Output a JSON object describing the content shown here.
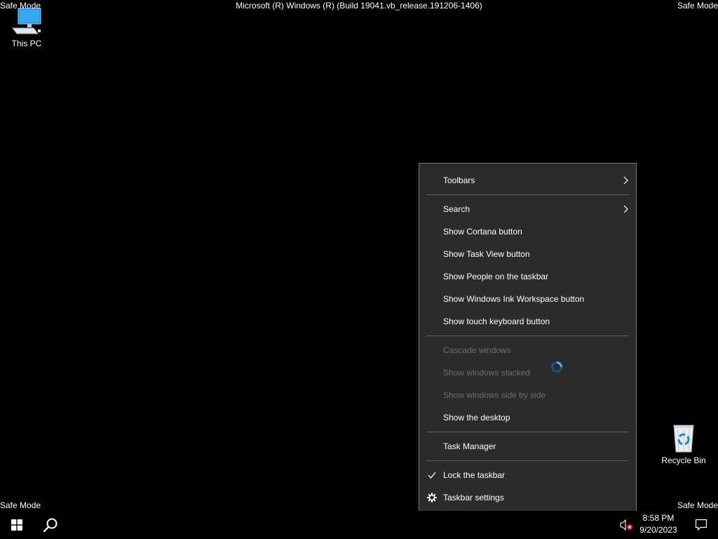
{
  "watermark": {
    "top_left": "Safe Mode",
    "top_right": "Safe Mode",
    "bottom_left": "Safe Mode",
    "bottom_right": "Safe Mode",
    "build": "Microsoft (R) Windows (R) (Build 19041.vb_release.191206-1406)"
  },
  "desktop": {
    "icons": [
      {
        "label": "This PC",
        "icon": "computer-icon"
      },
      {
        "label": "Recycle Bin",
        "icon": "recycle-bin-icon"
      }
    ]
  },
  "context_menu": {
    "items": {
      "toolbars": {
        "label": "Toolbars",
        "submenu": true,
        "enabled": true
      },
      "search": {
        "label": "Search",
        "submenu": true,
        "enabled": true
      },
      "show_cortana": {
        "label": "Show Cortana button",
        "enabled": true
      },
      "show_task_view": {
        "label": "Show Task View button",
        "enabled": true
      },
      "show_people": {
        "label": "Show People on the taskbar",
        "enabled": true
      },
      "show_ink": {
        "label": "Show Windows Ink Workspace button",
        "enabled": true
      },
      "show_touch_keyboard": {
        "label": "Show touch keyboard button",
        "enabled": true
      },
      "cascade": {
        "label": "Cascade windows",
        "enabled": false
      },
      "stacked": {
        "label": "Show windows stacked",
        "enabled": false
      },
      "side_by_side": {
        "label": "Show windows side by side",
        "enabled": false
      },
      "show_desktop": {
        "label": "Show the desktop",
        "enabled": true
      },
      "task_manager": {
        "label": "Task Manager",
        "enabled": true
      },
      "lock_taskbar": {
        "label": "Lock the taskbar",
        "checked": true,
        "enabled": true
      },
      "taskbar_settings": {
        "label": "Taskbar settings",
        "icon": "gear-icon",
        "enabled": true
      }
    }
  },
  "taskbar": {
    "clock": {
      "time": "8:58 PM",
      "date": "9/20/2023"
    },
    "volume_state": "muted"
  },
  "colors": {
    "menu_bg": "#2b2b2b",
    "menu_border": "#767676",
    "disabled_text": "#6d6d6d",
    "accent": "#0078d7"
  }
}
